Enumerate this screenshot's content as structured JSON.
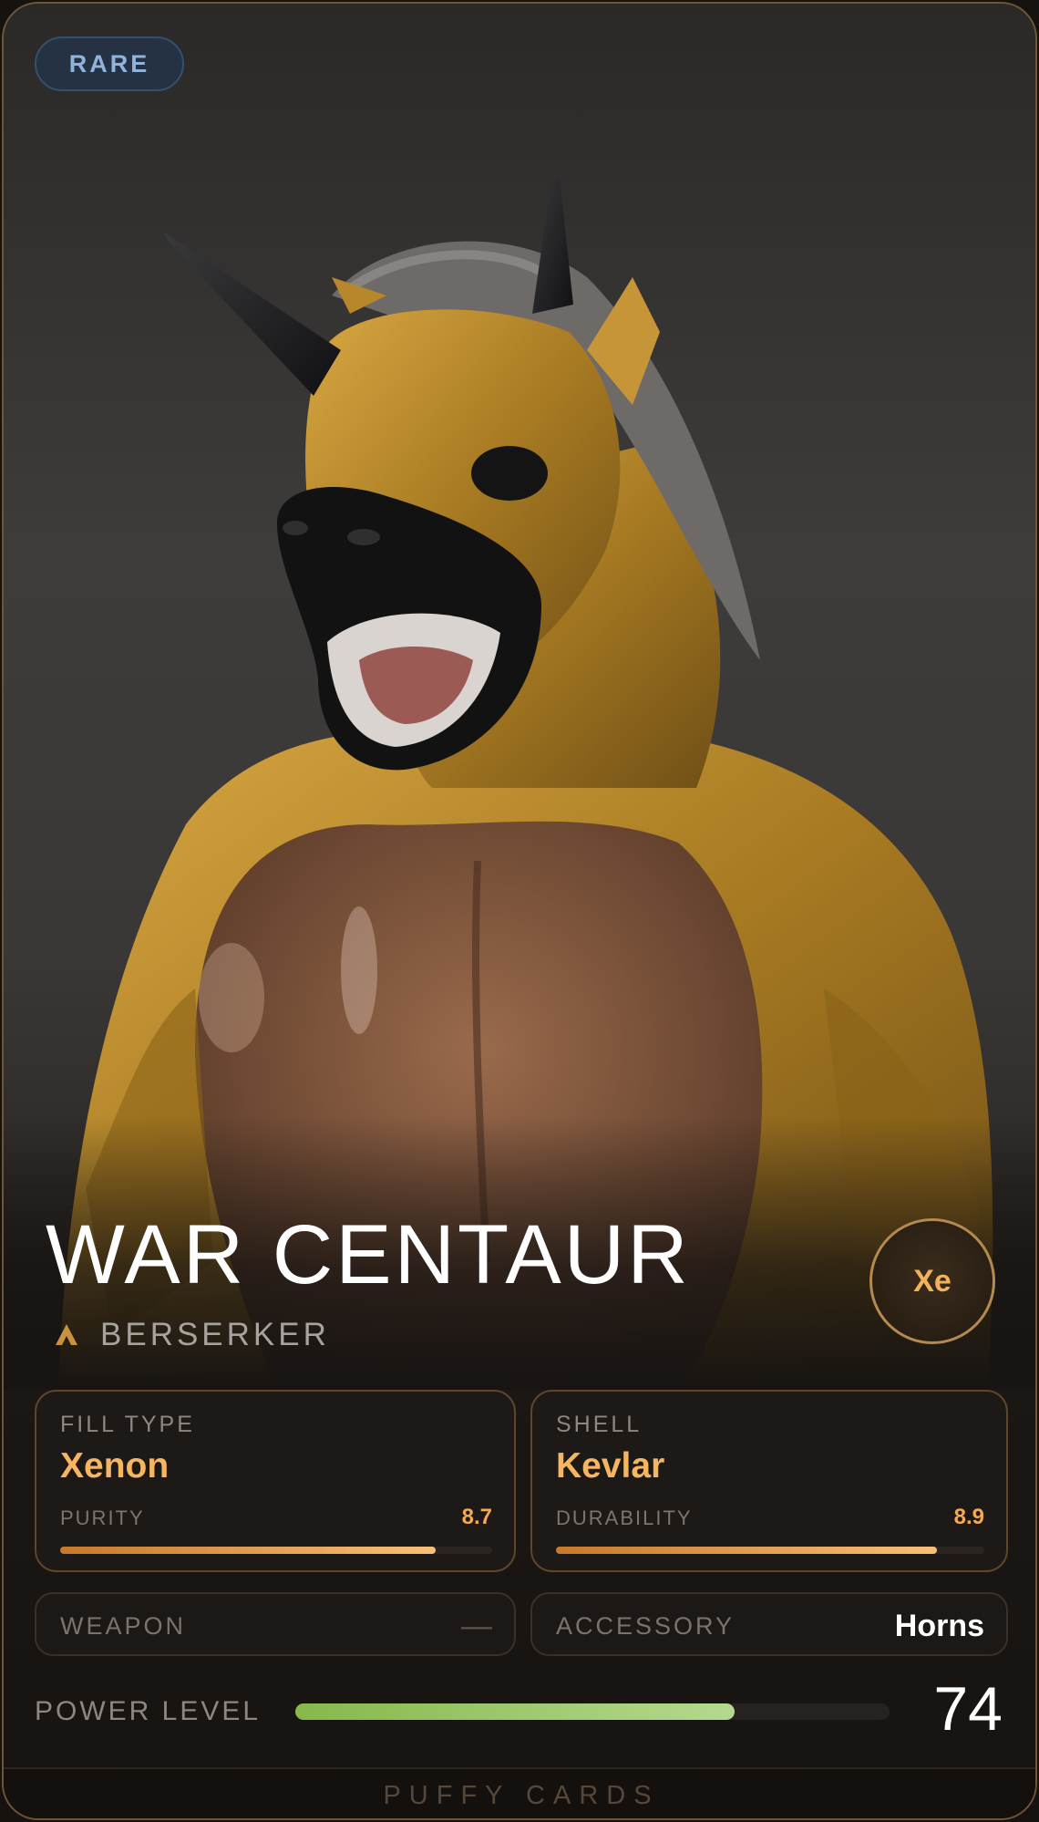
{
  "card": {
    "rarity": "RARE",
    "name": "WAR CENTAUR",
    "class_label": "BERSERKER",
    "class_icon": "class-chevron-icon",
    "element_symbol": "Xe"
  },
  "stats": {
    "fill": {
      "label": "FILL TYPE",
      "value": "Xenon",
      "metric_label": "PURITY",
      "metric_value": "8.7",
      "fraction": 0.87
    },
    "shell": {
      "label": "SHELL",
      "value": "Kevlar",
      "metric_label": "DURABILITY",
      "metric_value": "8.9",
      "fraction": 0.89
    }
  },
  "slots": {
    "weapon": {
      "label": "WEAPON",
      "value": "—"
    },
    "accessory": {
      "label": "ACCESSORY",
      "value": "Horns"
    }
  },
  "power": {
    "label": "POWER LEVEL",
    "value": "74",
    "fraction": 0.74
  },
  "footer": {
    "brand": "PUFFY CARDS"
  },
  "colors": {
    "accent": "#f6b561",
    "rare": "#8fb3dd",
    "power": "#9ccc6a"
  }
}
